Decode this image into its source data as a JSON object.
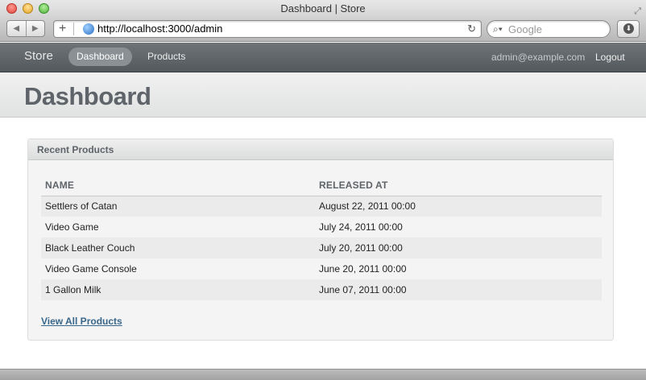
{
  "window": {
    "title": "Dashboard | Store"
  },
  "browser": {
    "url": "http://localhost:3000/admin",
    "search_placeholder": "Google",
    "icons": {
      "back": "back-arrow-icon",
      "forward": "forward-arrow-icon",
      "add_bookmark": "plus-icon",
      "site": "globe-icon",
      "reload": "reload-icon",
      "search": "search-icon",
      "downloads": "download-icon",
      "fullscreen": "fullscreen-icon"
    }
  },
  "nav": {
    "brand": "Store",
    "items": [
      {
        "label": "Dashboard",
        "active": true
      },
      {
        "label": "Products",
        "active": false
      }
    ],
    "user_email": "admin@example.com",
    "logout_label": "Logout"
  },
  "page": {
    "title": "Dashboard"
  },
  "panel": {
    "title": "Recent Products",
    "columns": [
      "NAME",
      "RELEASED AT"
    ],
    "rows": [
      {
        "name": "Settlers of Catan",
        "released_at": "August 22, 2011 00:00"
      },
      {
        "name": "Video Game",
        "released_at": "July 24, 2011 00:00"
      },
      {
        "name": "Black Leather Couch",
        "released_at": "July 20, 2011 00:00"
      },
      {
        "name": "Video Game Console",
        "released_at": "June 20, 2011 00:00"
      },
      {
        "name": "1 Gallon Milk",
        "released_at": "June 07, 2011 00:00"
      }
    ],
    "view_all_label": "View All Products"
  },
  "colors": {
    "nav_bg": "#5f6468",
    "title_text": "#5e6469",
    "link": "#38678b"
  }
}
